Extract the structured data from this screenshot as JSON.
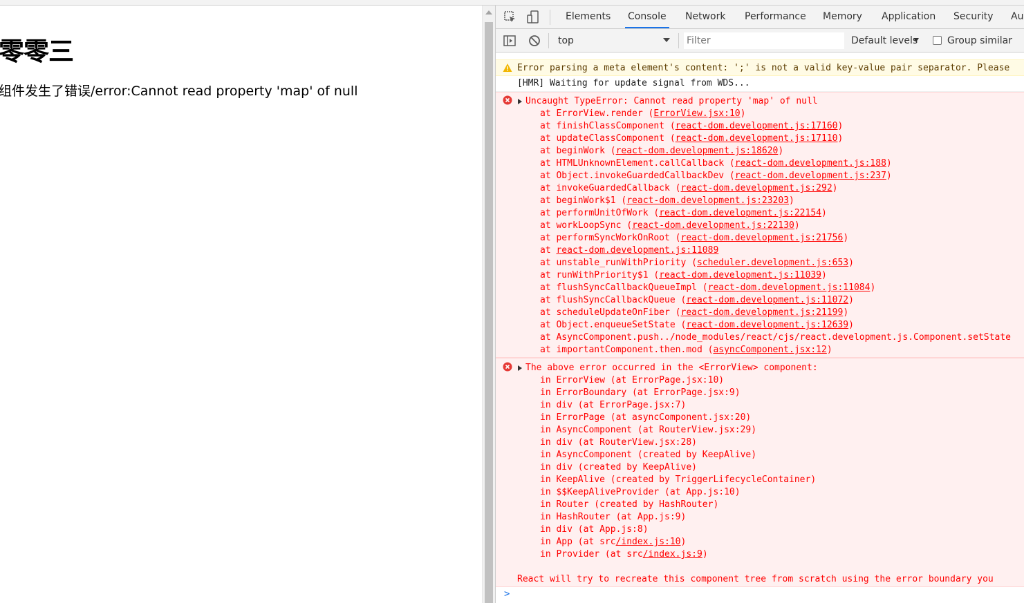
{
  "page": {
    "heading": "零零三",
    "message": "组件发生了错误/error:Cannot read property 'map' of null"
  },
  "devtools": {
    "tabs": [
      "Elements",
      "Console",
      "Network",
      "Performance",
      "Memory",
      "Application",
      "Security",
      "Au"
    ],
    "active_tab": "Console",
    "toolbar": {
      "context": "top",
      "filter_placeholder": "Filter",
      "levels": "Default levels",
      "group_similar": "Group similar"
    },
    "console": {
      "warning": "Error parsing a meta element's content: ';' is not a valid key-value pair separator. Please",
      "log": "[HMR] Waiting for update signal from WDS...",
      "error1": {
        "title": "Uncaught TypeError: Cannot read property 'map' of null",
        "stack": [
          {
            "fn": "at ErrorView.render (",
            "link": "ErrorView.jsx:10",
            "tail": ")"
          },
          {
            "fn": "at finishClassComponent (",
            "link": "react-dom.development.js:17160",
            "tail": ")"
          },
          {
            "fn": "at updateClassComponent (",
            "link": "react-dom.development.js:17110",
            "tail": ")"
          },
          {
            "fn": "at beginWork (",
            "link": "react-dom.development.js:18620",
            "tail": ")"
          },
          {
            "fn": "at HTMLUnknownElement.callCallback (",
            "link": "react-dom.development.js:188",
            "tail": ")"
          },
          {
            "fn": "at Object.invokeGuardedCallbackDev (",
            "link": "react-dom.development.js:237",
            "tail": ")"
          },
          {
            "fn": "at invokeGuardedCallback (",
            "link": "react-dom.development.js:292",
            "tail": ")"
          },
          {
            "fn": "at beginWork$1 (",
            "link": "react-dom.development.js:23203",
            "tail": ")"
          },
          {
            "fn": "at performUnitOfWork (",
            "link": "react-dom.development.js:22154",
            "tail": ")"
          },
          {
            "fn": "at workLoopSync (",
            "link": "react-dom.development.js:22130",
            "tail": ")"
          },
          {
            "fn": "at performSyncWorkOnRoot (",
            "link": "react-dom.development.js:21756",
            "tail": ")"
          },
          {
            "fn": "at ",
            "link": "react-dom.development.js:11089",
            "tail": ""
          },
          {
            "fn": "at unstable_runWithPriority (",
            "link": "scheduler.development.js:653",
            "tail": ")"
          },
          {
            "fn": "at runWithPriority$1 (",
            "link": "react-dom.development.js:11039",
            "tail": ")"
          },
          {
            "fn": "at flushSyncCallbackQueueImpl (",
            "link": "react-dom.development.js:11084",
            "tail": ")"
          },
          {
            "fn": "at flushSyncCallbackQueue (",
            "link": "react-dom.development.js:11072",
            "tail": ")"
          },
          {
            "fn": "at scheduleUpdateOnFiber (",
            "link": "react-dom.development.js:21199",
            "tail": ")"
          },
          {
            "fn": "at Object.enqueueSetState (",
            "link": "react-dom.development.js:12639",
            "tail": ")"
          },
          {
            "fn": "at AsyncComponent.push../node_modules/react/cjs/react.development.js.Component.setState",
            "link": "",
            "tail": ""
          },
          {
            "fn": "at importantComponent.then.mod (",
            "link": "asyncComponent.jsx:12",
            "tail": ")"
          }
        ]
      },
      "error2": {
        "title": "The above error occurred in the <ErrorView> component:",
        "stack": [
          {
            "fn": "in ErrorView (at ErrorPage.jsx:10)",
            "link": "",
            "tail": ""
          },
          {
            "fn": "in ErrorBoundary (at ErrorPage.jsx:9)",
            "link": "",
            "tail": ""
          },
          {
            "fn": "in div (at ErrorPage.jsx:7)",
            "link": "",
            "tail": ""
          },
          {
            "fn": "in ErrorPage (at asyncComponent.jsx:20)",
            "link": "",
            "tail": ""
          },
          {
            "fn": "in AsyncComponent (at RouterView.jsx:29)",
            "link": "",
            "tail": ""
          },
          {
            "fn": "in div (at RouterView.jsx:28)",
            "link": "",
            "tail": ""
          },
          {
            "fn": "in AsyncComponent (created by KeepAlive)",
            "link": "",
            "tail": ""
          },
          {
            "fn": "in div (created by KeepAlive)",
            "link": "",
            "tail": ""
          },
          {
            "fn": "in KeepAlive (created by TriggerLifecycleContainer)",
            "link": "",
            "tail": ""
          },
          {
            "fn": "in $$KeepAliveProvider (at App.js:10)",
            "link": "",
            "tail": ""
          },
          {
            "fn": "in Router (created by HashRouter)",
            "link": "",
            "tail": ""
          },
          {
            "fn": "in HashRouter (at App.js:9)",
            "link": "",
            "tail": ""
          },
          {
            "fn": "in div (at App.js:8)",
            "link": "",
            "tail": ""
          },
          {
            "fn": "in App (at src",
            "link": "/index.js:10",
            "tail": ")"
          },
          {
            "fn": "in Provider (at src",
            "link": "/index.js:9",
            "tail": ")"
          }
        ],
        "footer": "React will try to recreate this component tree from scratch using the error boundary you"
      },
      "prompt": ">"
    },
    "colors": {
      "error": "#ff0000",
      "error_bg": "#fff0f0",
      "warning_bg": "#fffbe5",
      "active_tab_underline": "#1a73e8"
    }
  }
}
